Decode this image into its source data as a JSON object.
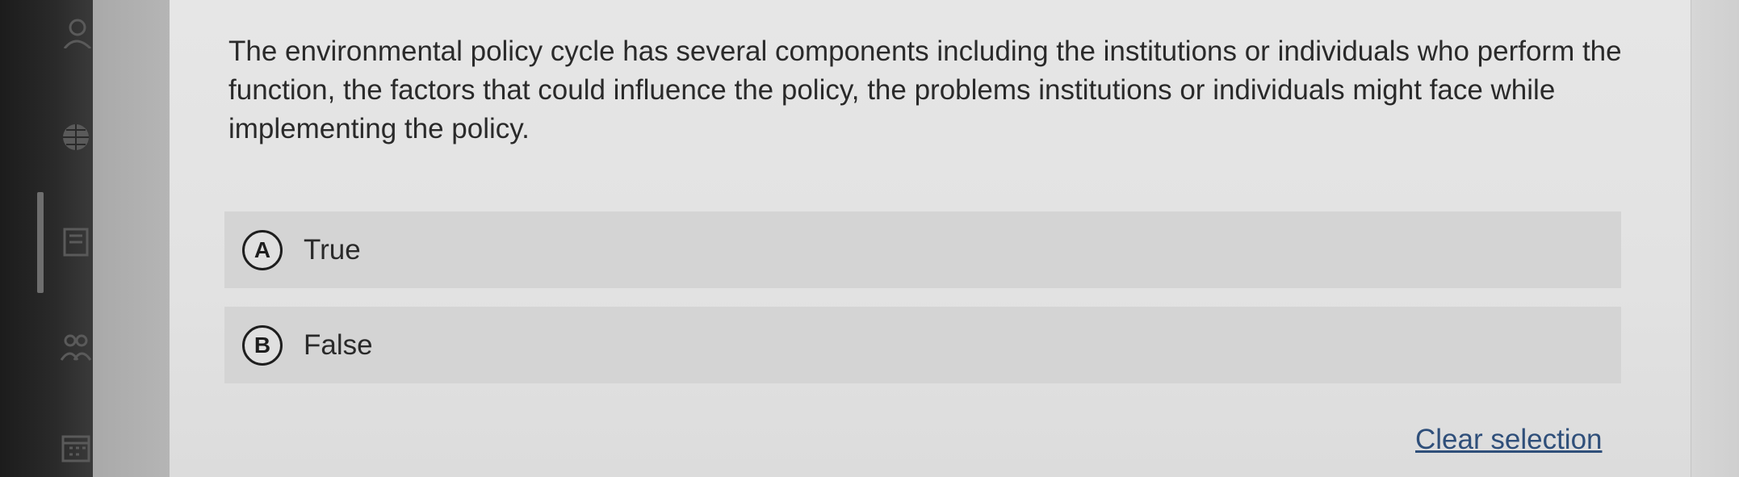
{
  "question": {
    "text": "The environmental policy cycle has several components including the institutions or individuals who perform the function, the factors that could influence the policy, the problems institutions or individuals might face while implementing the policy."
  },
  "options": [
    {
      "letter": "A",
      "label": "True"
    },
    {
      "letter": "B",
      "label": "False"
    }
  ],
  "actions": {
    "clear_selection": "Clear selection"
  },
  "sidebar": {
    "icons": [
      "user-icon",
      "globe-icon",
      "book-icon",
      "people-icon",
      "calendar-icon"
    ]
  },
  "colors": {
    "link": "#2f4f7a",
    "option_background": "#d4d4d4",
    "text": "#2a2a2a"
  }
}
